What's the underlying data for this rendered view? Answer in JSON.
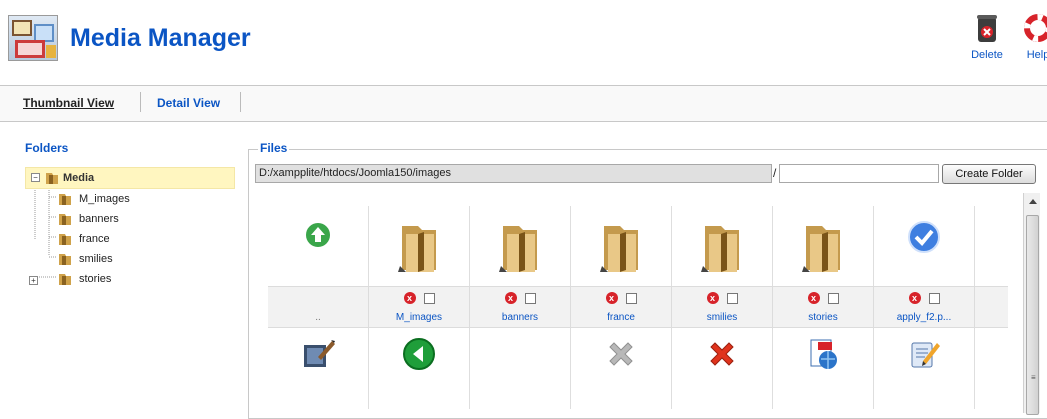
{
  "header": {
    "title": "Media Manager",
    "toolbar": {
      "delete_label": "Delete",
      "help_label": "Help"
    }
  },
  "tabs": {
    "thumbnail_label": "Thumbnail View",
    "detail_label": "Detail View"
  },
  "folders": {
    "title": "Folders",
    "root": "Media",
    "children": [
      "M_images",
      "banners",
      "france",
      "smilies",
      "stories"
    ]
  },
  "files": {
    "title": "Files",
    "path": "D:/xampplite/htdocs/Joomla150/images",
    "path_separator": "/",
    "new_folder_value": "",
    "create_folder_label": "Create Folder",
    "up_label": "..",
    "items": [
      "M_images",
      "banners",
      "france",
      "smilies",
      "stories",
      "apply_f2.p..."
    ]
  },
  "colors": {
    "link": "#0b55c4",
    "selected_row": "#fff6c0",
    "delete_red": "#d7232a"
  },
  "icons": {
    "up": "green-up-arrow-icon",
    "folder": "folder-icon",
    "apply": "check-icon",
    "bottom_row": [
      "edit-icon",
      "back-icon",
      "disabled-cross-icon",
      "red-cross-icon",
      "css-icon",
      "edit-note-icon"
    ]
  }
}
